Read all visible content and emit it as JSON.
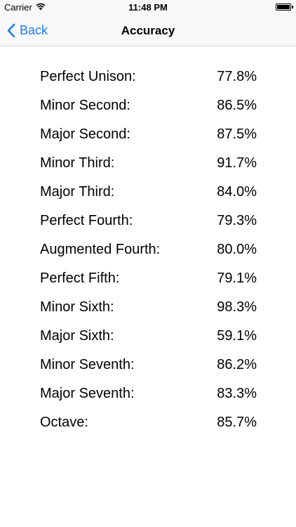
{
  "status_bar": {
    "carrier": "Carrier",
    "time": "11:48 PM",
    "icons": [
      "wifi-icon",
      "battery-icon"
    ]
  },
  "nav": {
    "back_label": "Back",
    "title": "Accuracy",
    "accent_color": "#1a7cf5",
    "back_icon": "chevron-left-icon"
  },
  "intervals": [
    {
      "name": "Perfect Unison:",
      "value": "77.8%"
    },
    {
      "name": "Minor Second:",
      "value": "86.5%"
    },
    {
      "name": "Major Second:",
      "value": "87.5%"
    },
    {
      "name": "Minor Third:",
      "value": "91.7%"
    },
    {
      "name": "Major Third:",
      "value": "84.0%"
    },
    {
      "name": "Perfect Fourth:",
      "value": "79.3%"
    },
    {
      "name": "Augmented Fourth:",
      "value": "80.0%"
    },
    {
      "name": "Perfect Fifth:",
      "value": "79.1%"
    },
    {
      "name": "Minor Sixth:",
      "value": "98.3%"
    },
    {
      "name": "Major Sixth:",
      "value": "59.1%"
    },
    {
      "name": "Minor Seventh:",
      "value": "86.2%"
    },
    {
      "name": "Major Seventh:",
      "value": "83.3%"
    },
    {
      "name": "Octave:",
      "value": "85.7%"
    }
  ]
}
